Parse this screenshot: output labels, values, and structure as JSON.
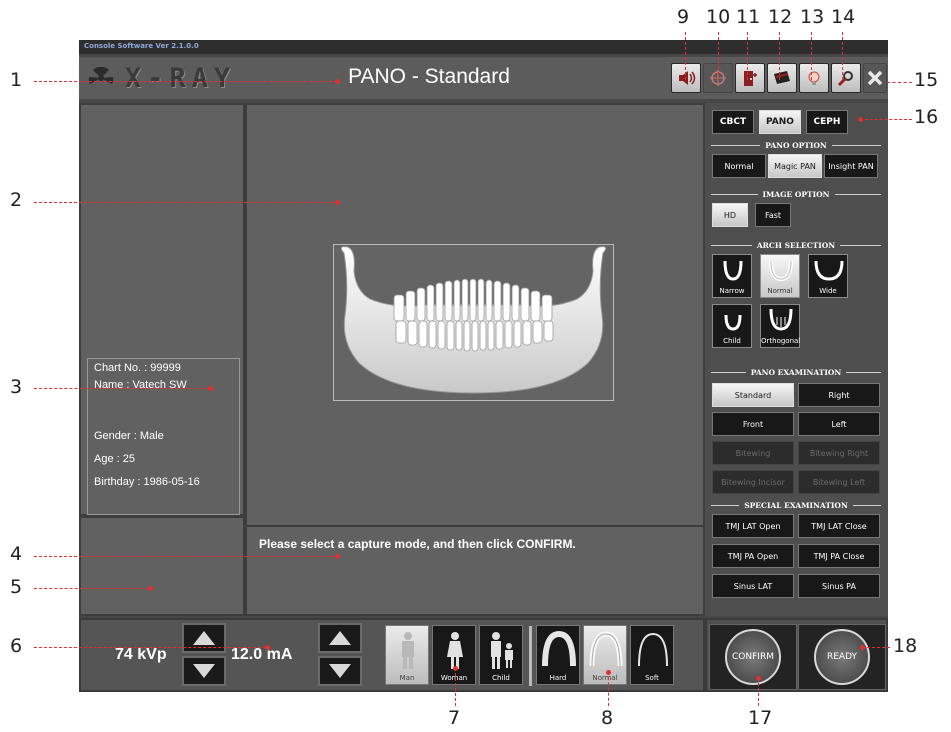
{
  "app": {
    "version": "Console Software Ver 2.1.0.0",
    "logo_text": "X-RAY",
    "mode_title": "PANO - Standard"
  },
  "toolbar": {
    "icons": [
      "speaker-icon",
      "laser-icon",
      "door-icon",
      "film-icon",
      "lamp-icon",
      "tools-icon",
      "close-icon"
    ]
  },
  "patient": {
    "chart_no": "Chart No. : 99999",
    "name": "Name : Vatech SW",
    "gender": "Gender : Male",
    "age": "Age : 25",
    "birthday": "Birthday : 1986-05-16"
  },
  "message": "Please select a capture mode, and then click CONFIRM.",
  "modality": {
    "tabs": [
      "CBCT",
      "PANO",
      "CEPH"
    ],
    "selected": "PANO"
  },
  "pano_option": {
    "title": "PANO OPTION",
    "items": [
      "Normal",
      "Magic PAN",
      "Insight PAN"
    ],
    "selected": "Magic PAN"
  },
  "image_option": {
    "title": "IMAGE OPTION",
    "items": [
      "HD",
      "Fast"
    ],
    "selected": "HD"
  },
  "arch_selection": {
    "title": "ARCH SELECTION",
    "items": [
      "Narrow",
      "Normal",
      "Wide",
      "Child",
      "Orthogonal"
    ],
    "selected": "Normal"
  },
  "pano_exam": {
    "title": "PANO EXAMINATION",
    "items": [
      "Standard",
      "Right",
      "Front",
      "Left",
      "Bitewing",
      "Bitewing Right",
      "Bitewing Incisor",
      "Bitewing Left"
    ],
    "selected": "Standard",
    "disabled": [
      "Bitewing",
      "Bitewing Right",
      "Bitewing Incisor",
      "Bitewing Left"
    ]
  },
  "special_exam": {
    "title": "SPECIAL EXAMINATION",
    "items": [
      "TMJ LAT Open",
      "TMJ LAT Close",
      "TMJ PA Open",
      "TMJ PA Close",
      "Sinus LAT",
      "Sinus PA"
    ]
  },
  "exposure": {
    "kvp": "74 kVp",
    "ma": "12.0 mA"
  },
  "patient_type": {
    "items": [
      "Man",
      "Woman",
      "Child"
    ],
    "selected": "Man"
  },
  "density": {
    "items": [
      "Hard",
      "Normal",
      "Soft"
    ],
    "selected": "Normal"
  },
  "actions": {
    "confirm": "CONFIRM",
    "ready": "READY"
  },
  "callouts": [
    "1",
    "2",
    "3",
    "4",
    "5",
    "6",
    "7",
    "8",
    "9",
    "10",
    "11",
    "12",
    "13",
    "14",
    "15",
    "16",
    "17",
    "18"
  ],
  "colors": {
    "window_bg": "#474747",
    "panel_bg": "#616161",
    "callout": "#e03030"
  }
}
